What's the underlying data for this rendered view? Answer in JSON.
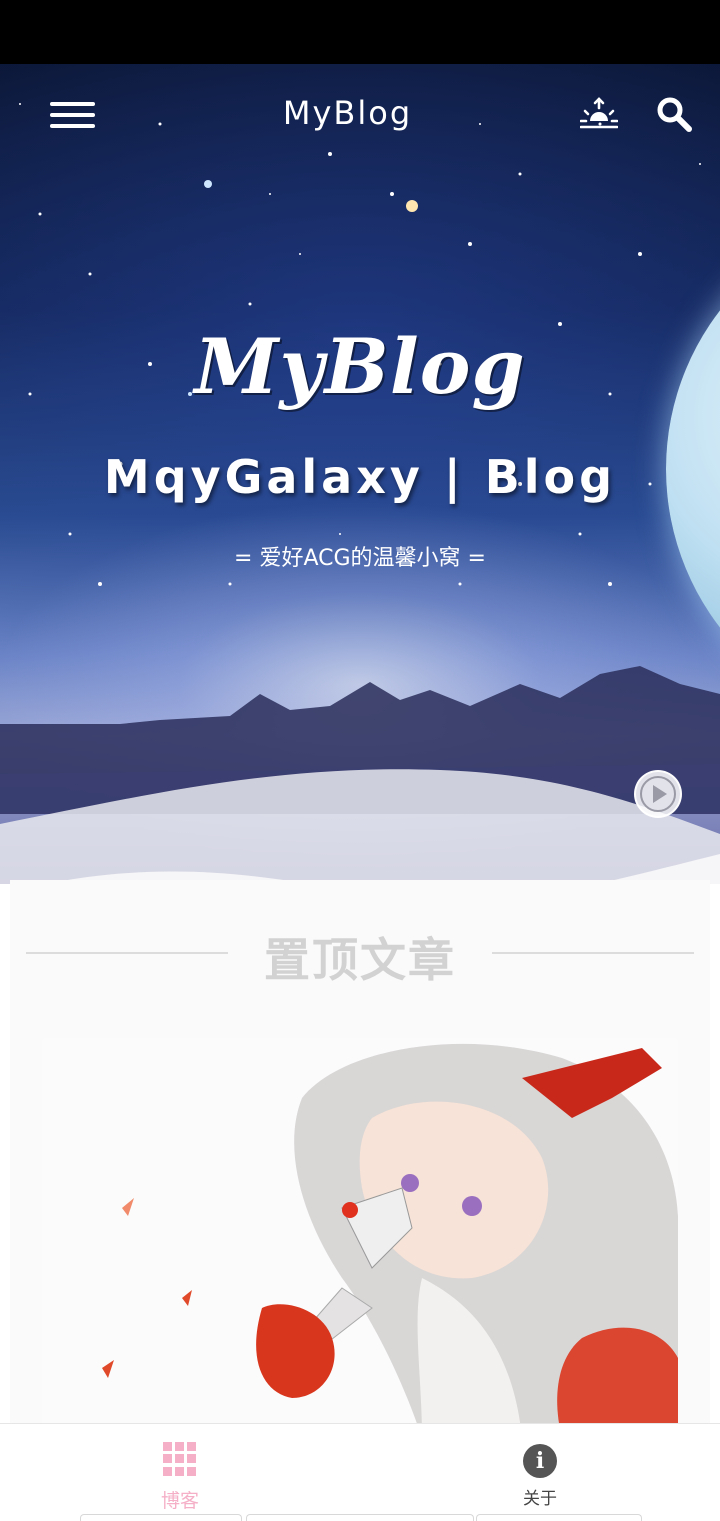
{
  "topbar": {
    "title": "MyBlog",
    "menu_icon": "menu-icon",
    "theme_icon": "sunrise-icon",
    "search_icon": "search-icon"
  },
  "hero": {
    "logo": "MyBlog",
    "subtitle": "MqyGalaxy | Blog",
    "motto": "= 爱好ACG的温馨小窝 =",
    "play_icon": "play-icon"
  },
  "pinned": {
    "title": "置顶文章"
  },
  "bottom_nav": {
    "items": [
      {
        "label": "博客",
        "icon": "grid-icon",
        "active": true
      },
      {
        "label": "关于",
        "icon": "info-icon",
        "active": false
      }
    ]
  },
  "colors": {
    "accent": "#f5b0c8",
    "status_bar": "#000000",
    "section_title": "#d2d2d2"
  }
}
